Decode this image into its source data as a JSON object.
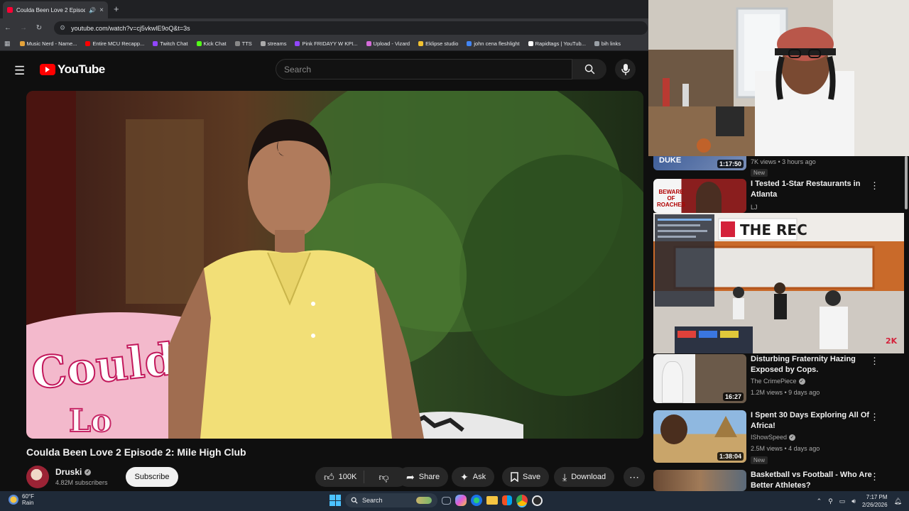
{
  "browser": {
    "tab_title": "Coulda Been Love 2 Episod",
    "new_tab": "+",
    "url": "youtube.com/watch?v=cj5vkwlE9oQ&t=3s",
    "bookmarks": [
      {
        "label": "Music Nerd - Name...",
        "color": "#e5a33a"
      },
      {
        "label": "Entire MCU Recapp...",
        "color": "#ff0000"
      },
      {
        "label": "Twitch Chat",
        "color": "#9146ff"
      },
      {
        "label": "Kick Chat",
        "color": "#53fc18"
      },
      {
        "label": "TTS",
        "color": "#888888"
      },
      {
        "label": "streams",
        "color": "#aaaaaa"
      },
      {
        "label": "Pink FRIDAYY W KPI...",
        "color": "#9146ff"
      },
      {
        "label": "Upload - Vizard",
        "color": "#d46bd8"
      },
      {
        "label": "Eklipse studio",
        "color": "#f2c230"
      },
      {
        "label": "john cena fleshlight",
        "color": "#4285f4"
      },
      {
        "label": "Rapidtags | YouTub...",
        "color": "#ffffff"
      },
      {
        "label": "bih links",
        "color": "#9aa0a6"
      }
    ]
  },
  "youtube": {
    "logo_text": "YouTube",
    "search_placeholder": "Search",
    "video_title": "Coulda Been Love 2 Episode 2: Mile High Club",
    "channel": {
      "name": "Druski",
      "subscribers": "4.82M subscribers",
      "subscribe_label": "Subscribe"
    },
    "actions": {
      "likes": "100K",
      "share": "Share",
      "ask": "Ask",
      "save": "Save",
      "download": "Download"
    }
  },
  "sidebar": {
    "partial": {
      "duration": "1:17:50",
      "meta": "7K views • 3 hours ago",
      "badge": "New"
    },
    "items": [
      {
        "title": "I Tested 1-Star Restaurants in Atlanta",
        "channel": "LJ",
        "thumb_text": "BEWARE OF ROACHES"
      },
      {
        "title": "Disturbing Fraternity Hazing Exposed by Cops.",
        "channel": "The CrimePiece",
        "meta": "1.2M views • 9 days ago",
        "duration": "16:27"
      },
      {
        "title": "I Spent 30 Days Exploring All Of Africa!",
        "channel": "IShowSpeed",
        "meta": "2.5M views • 4 days ago",
        "duration": "1:38:04",
        "badge": "New"
      },
      {
        "title": "Basketball vs Football - Who Are Better Athletes?"
      }
    ],
    "gameplay_sign": "THE REC",
    "gameplay_badge": "2K"
  },
  "taskbar": {
    "weather_temp": "60°F",
    "weather_desc": "Rain",
    "search_label": "Search",
    "time": "7:17 PM",
    "date": "2/26/2026"
  }
}
